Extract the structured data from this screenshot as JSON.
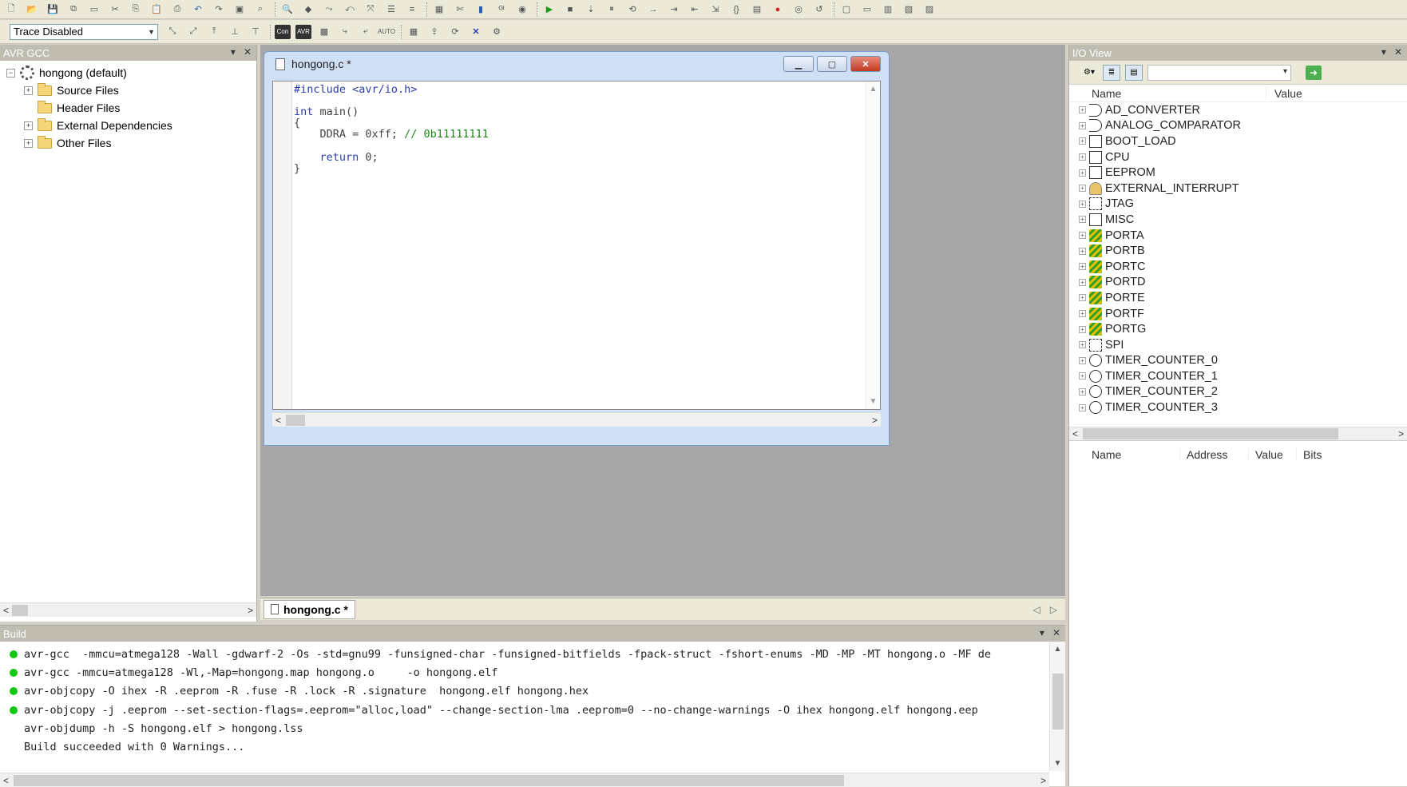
{
  "toolbar": {
    "trace_mode": "Trace Disabled"
  },
  "project_panel": {
    "title": "AVR GCC",
    "project_name": "hongong (default)",
    "folders": [
      "Source Files",
      "Header Files",
      "External Dependencies",
      "Other Files"
    ]
  },
  "editor": {
    "window_title": "hongong.c *",
    "lines": {
      "l1": "#include <avr/io.h>",
      "l2_kw": "int",
      "l2_rest": " main()",
      "l3": "{",
      "l4_code": "    DDRA = 0xff; ",
      "l4_comment": "// 0b11111111",
      "l5_kw": "    return",
      "l5_rest": " 0;",
      "l6": "}"
    },
    "tab_label": "hongong.c *"
  },
  "io_view": {
    "title": "I/O View",
    "col_name": "Name",
    "col_value": "Value",
    "modules": [
      {
        "name": "AD_CONVERTER",
        "icon": "converter-icon"
      },
      {
        "name": "ANALOG_COMPARATOR",
        "icon": "comparator-icon"
      },
      {
        "name": "BOOT_LOAD",
        "icon": "register-icon"
      },
      {
        "name": "CPU",
        "icon": "register-icon"
      },
      {
        "name": "EEPROM",
        "icon": "register-icon"
      },
      {
        "name": "EXTERNAL_INTERRUPT",
        "icon": "interrupt-icon"
      },
      {
        "name": "JTAG",
        "icon": "jtag-icon"
      },
      {
        "name": "MISC",
        "icon": "register-icon"
      },
      {
        "name": "PORTA",
        "icon": "port-icon"
      },
      {
        "name": "PORTB",
        "icon": "port-icon"
      },
      {
        "name": "PORTC",
        "icon": "port-icon"
      },
      {
        "name": "PORTD",
        "icon": "port-icon"
      },
      {
        "name": "PORTE",
        "icon": "port-icon"
      },
      {
        "name": "PORTF",
        "icon": "port-icon"
      },
      {
        "name": "PORTG",
        "icon": "port-icon"
      },
      {
        "name": "SPI",
        "icon": "jtag-icon"
      },
      {
        "name": "TIMER_COUNTER_0",
        "icon": "timer-icon"
      },
      {
        "name": "TIMER_COUNTER_1",
        "icon": "timer-icon"
      },
      {
        "name": "TIMER_COUNTER_2",
        "icon": "timer-icon"
      },
      {
        "name": "TIMER_COUNTER_3",
        "icon": "timer-icon"
      }
    ],
    "detail_cols": [
      "Name",
      "Address",
      "Value",
      "Bits"
    ]
  },
  "build": {
    "title": "Build",
    "lines": [
      {
        "text": "avr-gcc  -mmcu=atmega128 -Wall -gdwarf-2 -Os -std=gnu99 -funsigned-char -funsigned-bitfields -fpack-struct -fshort-enums -MD -MP -MT hongong.o -MF de",
        "ok": true
      },
      {
        "text": "avr-gcc -mmcu=atmega128 -Wl,-Map=hongong.map hongong.o     -o hongong.elf",
        "ok": true
      },
      {
        "text": "avr-objcopy -O ihex -R .eeprom -R .fuse -R .lock -R .signature  hongong.elf hongong.hex",
        "ok": true
      },
      {
        "text": "avr-objcopy -j .eeprom --set-section-flags=.eeprom=\"alloc,load\" --change-section-lma .eeprom=0 --no-change-warnings -O ihex hongong.elf hongong.eep",
        "ok": true
      },
      {
        "text": "avr-objdump -h -S hongong.elf > hongong.lss",
        "ok": false
      },
      {
        "text": "Build succeeded with 0 Warnings...",
        "ok": false
      }
    ]
  },
  "colors": {
    "status_ok": "#14c814",
    "keyword": "#2a3fb0",
    "comment": "#1e8a1e"
  }
}
